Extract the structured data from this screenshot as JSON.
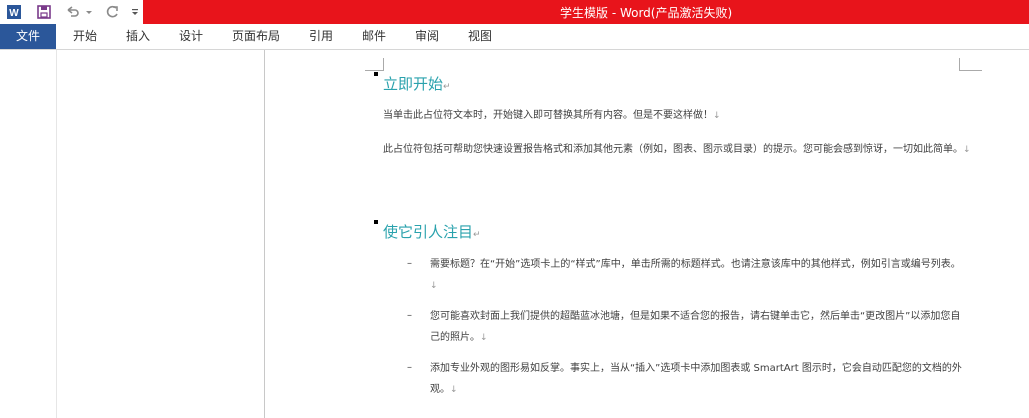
{
  "window": {
    "title": "学生模版 -  Word(产品激活失败)",
    "accent_color": "#e8141b",
    "file_tab_color": "#2b579a"
  },
  "quick_access": {
    "icons": [
      "word-logo-icon",
      "save-icon",
      "undo-icon",
      "redo-icon",
      "customize-qat-icon"
    ]
  },
  "ribbon": {
    "tabs": [
      {
        "label": "文件"
      },
      {
        "label": "开始"
      },
      {
        "label": "插入"
      },
      {
        "label": "设计"
      },
      {
        "label": "页面布局"
      },
      {
        "label": "引用"
      },
      {
        "label": "邮件"
      },
      {
        "label": "审阅"
      },
      {
        "label": "视图"
      }
    ]
  },
  "document": {
    "section1": {
      "heading": "立即开始",
      "paragraphs": [
        "当单击此占位符文本时，开始键入即可替换其所有内容。但是不要这样做！",
        "此占位符包括可帮助您快速设置报告格式和添加其他元素（例如，图表、图示或目录）的提示。您可能会感到惊讶，一切如此简单。"
      ]
    },
    "section2": {
      "heading": "使它引人注目",
      "bullet_symbol": "–",
      "bullets": [
        "需要标题？在“开始”选项卡上的“样式”库中，单击所需的标题样式。也请注意该库中的其他样式，例如引言或编号列表。",
        "您可能喜欢封面上我们提供的超酷蓝冰池塘，但是如果不适合您的报告，请右键单击它，然后单击“更改图片”以添加您自己的照片。",
        "添加专业外观的图形易如反掌。事实上，当从“插入”选项卡中添加图表或 SmartArt 图示时，它会自动匹配您的文档的外观。"
      ]
    },
    "marks": {
      "paragraph_mark": "↵",
      "line_end_mark": "↓"
    }
  }
}
